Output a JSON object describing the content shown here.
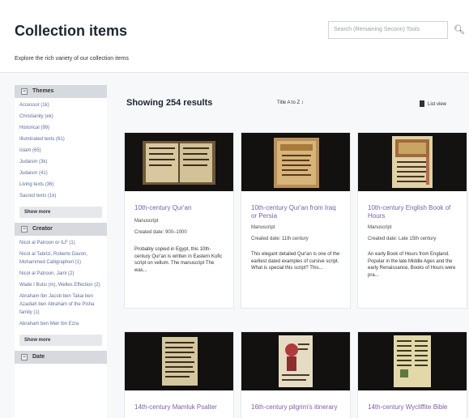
{
  "header": {
    "title": "Collection items",
    "subtitle": "Explore the rich variety of our collection items",
    "search_placeholder": "Search (Remaining Seconn) Tools",
    "search_icon": "search-icon"
  },
  "sidebar": {
    "facets": [
      {
        "name": "Themes",
        "items": [
          {
            "label": "Accessor",
            "count": "(1k)"
          },
          {
            "label": "Christianity",
            "count": "(ek)"
          },
          {
            "label": "Historical",
            "count": "(99)"
          },
          {
            "label": "Illuminated texts",
            "count": "(61)"
          },
          {
            "label": "Islam",
            "count": "(65)"
          },
          {
            "label": "Judaism",
            "count": "(3k)"
          },
          {
            "label": "Judaism",
            "count": "(41)"
          },
          {
            "label": "Living texts",
            "count": "(36)"
          },
          {
            "label": "Sacred texts",
            "count": "(1k)"
          }
        ],
        "show_more": "Show more"
      },
      {
        "name": "Creator",
        "items": [
          {
            "label": "Nicol al Patroon or ILF",
            "count": "(1)"
          },
          {
            "label": "Nicol al Tabrizi, Roberto Davon, Mohammed Calligrapheri",
            "count": "(1)"
          },
          {
            "label": "Nicol al Patroon, Jami",
            "count": "(2)"
          },
          {
            "label": "Wade I Butsi (m), Welles Effection",
            "count": "(2)"
          },
          {
            "label": "Abraham Ibn Jacob ben Takai ben Azadiah ben Abraham of the Pisha family",
            "count": "(1)"
          },
          {
            "label": "Abraham ben Meir ibn Ezra",
            "count": ""
          }
        ],
        "show_more": "Show more"
      },
      {
        "name": "Date",
        "items": [],
        "show_more": ""
      }
    ]
  },
  "results": {
    "count_label": "Showing 254 results",
    "sort_label": "Title A to Z",
    "list_view_label": "List view",
    "list_view_icon": "list-view-icon"
  },
  "cards": [
    {
      "title": "10th-century Qur'an",
      "type": "Manuscript",
      "created": "Created date: 900–1000",
      "description": "Probably copied in Egypt, this 10th-century Qur'an is written in Eastern Kufic script on vellum. The manuscript The was..."
    },
    {
      "title": "10th-century Qur'an from Iraq or Persia",
      "type": "Manuscript",
      "created": "Created date: 11th century",
      "description": "This elegant detailed Qur'an is one of the earliest dated examples of cursive script. What is special this script? This..."
    },
    {
      "title": "10th-century English Book of Hours",
      "type": "Manuscript",
      "created": "Created date: Late 15th century",
      "description": "An early Book of Hours from England. Popular in the late Middle Ages and the early Renaissance, Books of Hours were pra..."
    },
    {
      "title": "14th-century Mamluk Psalter",
      "type": "",
      "created": "",
      "description": ""
    },
    {
      "title": "16th-century pilgrim's itinerary",
      "type": "",
      "created": "",
      "description": ""
    },
    {
      "title": "14th-century Wycliffite Bible",
      "type": "",
      "created": "",
      "description": ""
    }
  ],
  "colors": {
    "accent_link": "#5a6d9a",
    "card_title": "#7a5fa6",
    "facet_header_bg": "#d6d9de"
  }
}
